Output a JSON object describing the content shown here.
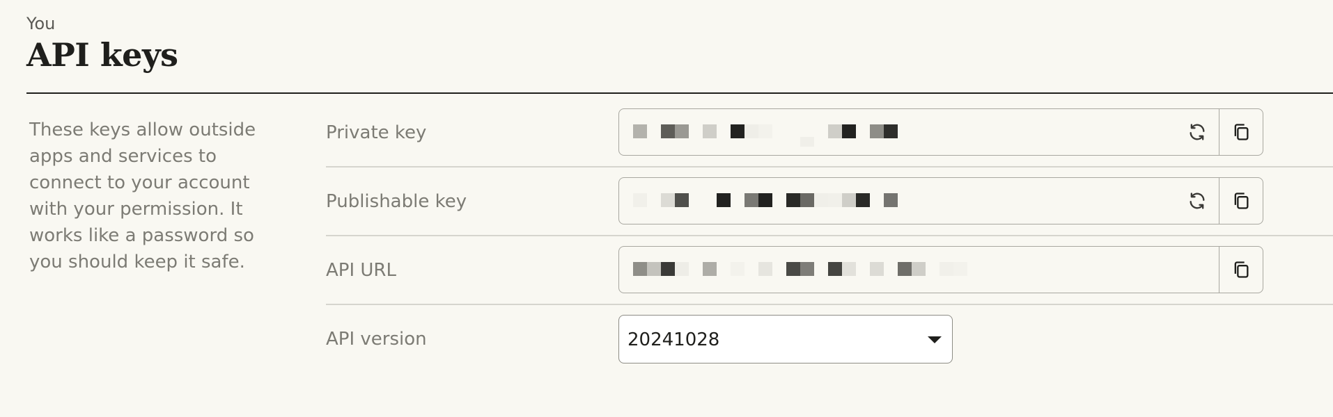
{
  "header": {
    "eyebrow": "You",
    "title": "API keys"
  },
  "description": "These keys allow outside apps and services to connect to your account with your permission. It works like a password so you should keep it safe.",
  "rows": [
    {
      "label": "Private key",
      "value_redacted": true,
      "actions": [
        "refresh-icon",
        "copy-icon"
      ]
    },
    {
      "label": "Publishable key",
      "value_redacted": true,
      "actions": [
        "refresh-icon",
        "copy-icon"
      ]
    },
    {
      "label": "API URL",
      "value_redacted": true,
      "actions": [
        "copy-icon"
      ]
    },
    {
      "label": "API version",
      "selected": "20241028"
    }
  ],
  "colors": {
    "background": "#f9f8f2",
    "text": "#1f1f1c",
    "muted": "#7c7b74",
    "border": "#a8a7a0"
  }
}
